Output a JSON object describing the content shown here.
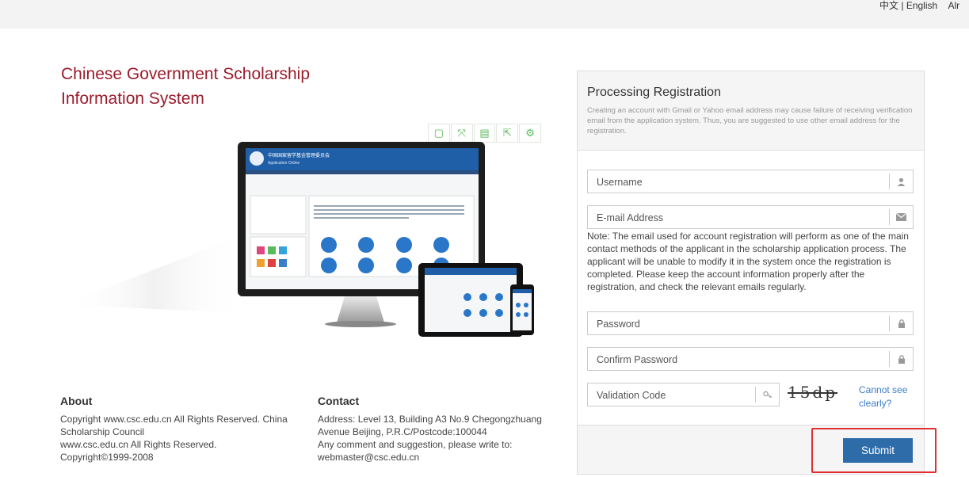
{
  "topbar": {
    "lang_zh": "中文",
    "sep": " | ",
    "lang_en": "English",
    "extra": "Alr"
  },
  "title": {
    "line1": "Chinese Government Scholarship",
    "line2": "Information System"
  },
  "toolbar_icons": [
    "tablet-icon",
    "expand-icon",
    "save-icon",
    "share-icon",
    "settings-icon"
  ],
  "hero": {
    "screen_title": "中国国家留学基金管理委员会",
    "screen_sub": "Application Online"
  },
  "form": {
    "heading": "Processing Registration",
    "notice": "Creating an account with Gmail or Yahoo email address may cause failure of receiving verification email from the application system. Thus, you are suggested to use other email address for the registration.",
    "username_placeholder": "Username",
    "email_placeholder": "E-mail Address",
    "email_note": "Note: The email used for account registration will perform as one of the main contact methods of the applicant in the scholarship application process. The applicant will be unable to modify it in the system once the registration is completed. Please keep the account information properly after the registration, and check the relevant emails regularly.",
    "password_placeholder": "Password",
    "confirm_placeholder": "Confirm Password",
    "validation_placeholder": "Validation Code",
    "captcha_text": "15dp",
    "cant_see": "Cannot see clearly?",
    "submit_label": "Submit"
  },
  "footer": {
    "about_title": "About",
    "about_lines": [
      "Copyright www.csc.edu.cn All Rights Reserved. China",
      "Scholarship Council",
      "www.csc.edu.cn All Rights Reserved.",
      "Copyright©1999-2008"
    ],
    "contact_title": "Contact",
    "contact_lines": [
      "Address: Level 13, Building A3 No.9 Chegongzhuang",
      "Avenue Beijing, P.R.C/Postcode:100044",
      "Any comment and suggestion, please write to:",
      "webmaster@csc.edu.cn"
    ]
  },
  "colors": {
    "brand": "#9b1b2b",
    "button": "#2d6ca8",
    "highlight": "#e03030",
    "tool_icon": "#5cb85c"
  }
}
